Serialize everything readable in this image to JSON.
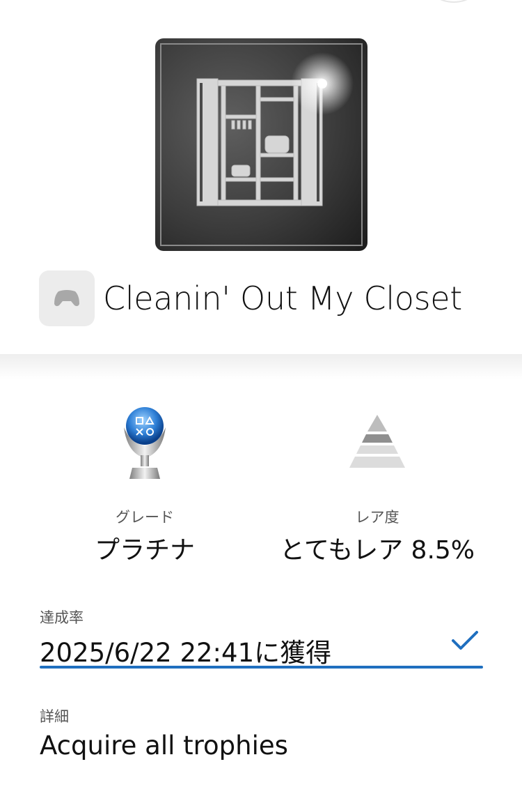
{
  "trophy": {
    "name": "Cleanin' Out My Closet",
    "hero_icon": "closet-icon",
    "game_icon": "gamepad-icon"
  },
  "stats": {
    "grade_label": "グレード",
    "grade_value": "プラチナ",
    "grade_icon": "platinum-trophy-icon",
    "rarity_label": "レア度",
    "rarity_value": "とてもレア 8.5%",
    "rarity_icon": "pyramid-icon"
  },
  "progress": {
    "label": "達成率",
    "value": "2025/6/22  22:41に獲得",
    "accent_color": "#1f6fbf",
    "check_icon": "checkmark-icon"
  },
  "details": {
    "label": "詳細",
    "value": "Acquire all trophies"
  }
}
